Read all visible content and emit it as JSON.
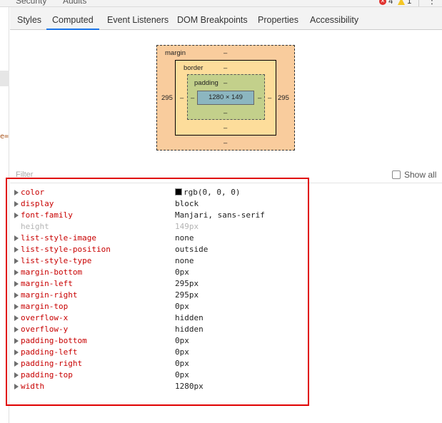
{
  "topbar": {
    "tabs": [
      "Security",
      "Audits"
    ],
    "error_count": "4",
    "warning_count": "1",
    "more_icon": "⋮"
  },
  "leftstrip": {
    "fragment": "e="
  },
  "subtabs": [
    {
      "label": "Styles",
      "active": false
    },
    {
      "label": "Computed",
      "active": true
    },
    {
      "label": "Event Listeners",
      "active": false
    },
    {
      "label": "DOM Breakpoints",
      "active": false
    },
    {
      "label": "Properties",
      "active": false
    },
    {
      "label": "Accessibility",
      "active": false
    }
  ],
  "box_model": {
    "margin_label": "margin",
    "margin_top": "–",
    "margin_bottom": "–",
    "margin_left": "295",
    "margin_right": "295",
    "border_label": "border",
    "border_top": "–",
    "border_bottom": "–",
    "border_left": "–",
    "border_right": "–",
    "padding_label": "padding",
    "padding_top": "–",
    "padding_bottom": "–",
    "padding_left": "–",
    "padding_right": "–",
    "content_size": "1280 × 149",
    "colors": {
      "margin": "#f9cc9d",
      "border": "#fddd9b",
      "padding": "#c3d08b",
      "content": "#8cb6c0"
    }
  },
  "filter": {
    "placeholder": "Filter",
    "show_all_label": "Show all",
    "show_all_checked": false
  },
  "computed": [
    {
      "name": "color",
      "value": "rgb(0, 0, 0)",
      "swatch": "#000000",
      "inactive": false
    },
    {
      "name": "display",
      "value": "block",
      "inactive": false
    },
    {
      "name": "font-family",
      "value": "Manjari, sans-serif",
      "inactive": false
    },
    {
      "name": "height",
      "value": "149px",
      "inactive": true
    },
    {
      "name": "list-style-image",
      "value": "none",
      "inactive": false
    },
    {
      "name": "list-style-position",
      "value": "outside",
      "inactive": false
    },
    {
      "name": "list-style-type",
      "value": "none",
      "inactive": false
    },
    {
      "name": "margin-bottom",
      "value": "0px",
      "inactive": false
    },
    {
      "name": "margin-left",
      "value": "295px",
      "inactive": false
    },
    {
      "name": "margin-right",
      "value": "295px",
      "inactive": false
    },
    {
      "name": "margin-top",
      "value": "0px",
      "inactive": false
    },
    {
      "name": "overflow-x",
      "value": "hidden",
      "inactive": false
    },
    {
      "name": "overflow-y",
      "value": "hidden",
      "inactive": false
    },
    {
      "name": "padding-bottom",
      "value": "0px",
      "inactive": false
    },
    {
      "name": "padding-left",
      "value": "0px",
      "inactive": false
    },
    {
      "name": "padding-right",
      "value": "0px",
      "inactive": false
    },
    {
      "name": "padding-top",
      "value": "0px",
      "inactive": false
    },
    {
      "name": "width",
      "value": "1280px",
      "inactive": false
    }
  ],
  "highlight_color": "#e00000",
  "accent_color": "#1a73e8",
  "property_name_color": "#c80000"
}
